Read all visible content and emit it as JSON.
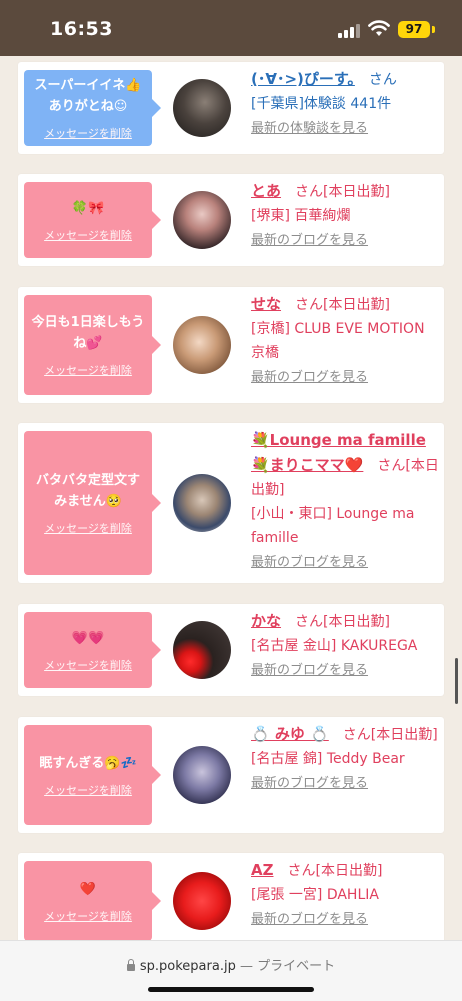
{
  "status": {
    "time": "16:53",
    "battery": "97"
  },
  "browser": {
    "domain": "sp.pokepara.jp",
    "separator": " — ",
    "privacy": "プライベート"
  },
  "colors": {
    "pink": "#f994a4",
    "blue": "#7fb3f5",
    "name_pink": "#e0405e",
    "name_blue": "#2a6fb8",
    "status_bar": "#5b4a3d"
  },
  "cards": [
    {
      "bubble_text": "スーパーイイネ👍ありがとね☺",
      "delete": "メッセージを削除",
      "name": "(･∀･>)ぴーす。",
      "suffix": "　さん",
      "shop": "[千葉県]体験談 441件",
      "latest": "最新の体験談を見る"
    },
    {
      "bubble_text": "🍀🎀",
      "delete": "メッセージを削除",
      "name": "とあ",
      "suffix": "　さん[本日出勤]",
      "shop": "[堺東] 百華絢爛",
      "latest": "最新のブログを見る"
    },
    {
      "bubble_text": "今日も1日楽しもうね💕",
      "delete": "メッセージを削除",
      "name": "せな",
      "suffix": "　さん[本日出勤]",
      "shop": "[京橋] CLUB EVE MOTION 京橋",
      "latest": "最新のブログを見る"
    },
    {
      "bubble_text": "バタバタ定型文すみません🥺",
      "delete": "メッセージを削除",
      "name": "💐Lounge ma famille💐まりこママ❤️",
      "suffix": "　さん[本日出勤]",
      "shop": "[小山・東口] Lounge ma famille",
      "latest": "最新のブログを見る"
    },
    {
      "bubble_text": "💗💗",
      "delete": "メッセージを削除",
      "name": "かな",
      "suffix": "　さん[本日出勤]",
      "shop": "[名古屋 金山] KAKUREGA",
      "latest": "最新のブログを見る"
    },
    {
      "bubble_text": "眠すんぎる🥱💤",
      "delete": "メッセージを削除",
      "name": "💍 みゆ 💍",
      "suffix": "　さん[本日出勤]",
      "shop": "[名古屋 錦] Teddy Bear",
      "latest": "最新のブログを見る"
    },
    {
      "bubble_text": "❤️",
      "delete": "メッセージを削除",
      "name": "AZ",
      "suffix": "　さん[本日出勤]",
      "shop": "[尾張 一宮] DAHLIA",
      "latest": "最新のブログを見る"
    }
  ]
}
